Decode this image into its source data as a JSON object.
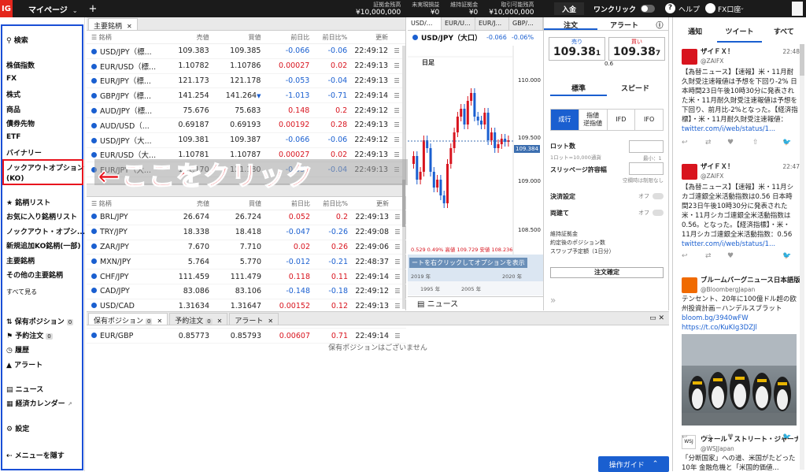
{
  "topbar": {
    "logo": "IG",
    "my_page_tab": "マイページ",
    "plus": "+",
    "stats": [
      {
        "label": "証拠金残高",
        "value": "¥10,000,000"
      },
      {
        "label": "未実現損益",
        "value": "¥0"
      },
      {
        "label": "維持証拠金",
        "value": "¥0"
      },
      {
        "label": "取引可能残高",
        "value": "¥10,000,000"
      }
    ],
    "deposit_button": "入金",
    "one_click_label": "ワンクリック",
    "help_label": "ヘルプ",
    "user_label": "FX口座"
  },
  "sidebar": {
    "search_label": "検索",
    "categories": [
      "株価指数",
      "FX",
      "株式",
      "商品",
      "債券先物",
      "ETF",
      "バイナリー"
    ],
    "knockout_line1": "ノックアウトオプション",
    "knockout_line2": "(KO)",
    "lists": [
      {
        "label": "銘柄リスト"
      },
      {
        "label": "お気に入り銘柄リスト"
      },
      {
        "label": "ノックアウト・オプシ..."
      },
      {
        "label": "新規追加KO銘柄(一部)"
      },
      {
        "label": "主要銘柄"
      },
      {
        "label": "その他の主要銘柄"
      }
    ],
    "see_all": "すべて見る",
    "account": [
      {
        "label": "保有ポジション",
        "badge": "0"
      },
      {
        "label": "予約注文",
        "badge": "0"
      },
      {
        "label": "履歴"
      },
      {
        "label": "アラート"
      }
    ],
    "news_label": "ニュース",
    "calendar_label": "経済カレンダー",
    "settings_label": "設定",
    "hide_menu_label": "メニューを隠す"
  },
  "annotation": {
    "text": "←ここをクリック",
    "color": "#e8141e"
  },
  "watchlist": {
    "tab_label": "主要銘柄",
    "headers": {
      "name": "銘柄",
      "sell": "売値",
      "buy": "買値",
      "change": "前日比",
      "pct": "前日比%",
      "time": "更新"
    },
    "rows_top": [
      {
        "name": "USD/JPY（標...",
        "sell": "109.383",
        "buy": "109.385",
        "arrow": "",
        "change": "-0.066",
        "pct": "-0.06",
        "time": "22:49:12"
      },
      {
        "name": "EUR/USD（標...",
        "sell": "1.10782",
        "buy": "1.10786",
        "arrow": "",
        "change": "0.00027",
        "pct": "0.02",
        "time": "22:49:13"
      },
      {
        "name": "EUR/JPY（標...",
        "sell": "121.173",
        "buy": "121.178",
        "arrow": "",
        "change": "-0.053",
        "pct": "-0.04",
        "time": "22:49:13"
      },
      {
        "name": "GBP/JPY（標...",
        "sell": "141.254",
        "buy": "141.264",
        "arrow": "▼",
        "change": "-1.013",
        "pct": "-0.71",
        "time": "22:49:14"
      },
      {
        "name": "AUD/JPY（標...",
        "sell": "75.676",
        "buy": "75.683",
        "arrow": "",
        "change": "0.148",
        "pct": "0.2",
        "time": "22:49:12"
      },
      {
        "name": "AUD/USD（...",
        "sell": "0.69187",
        "buy": "0.69193",
        "arrow": "",
        "change": "0.00192",
        "pct": "0.28",
        "time": "22:49:13"
      },
      {
        "name": "USD/JPY（大...",
        "sell": "109.381",
        "buy": "109.387",
        "arrow": "",
        "change": "-0.066",
        "pct": "-0.06",
        "time": "22:49:12"
      },
      {
        "name": "EUR/USD（大...",
        "sell": "1.10781",
        "buy": "1.10787",
        "arrow": "",
        "change": "0.00027",
        "pct": "0.02",
        "time": "22:49:13"
      },
      {
        "name": "EUR/JPY（大...",
        "sell": "121.170",
        "buy": "121.180",
        "arrow": "",
        "change": "-0.053",
        "pct": "-0.04",
        "time": "22:49:13"
      }
    ],
    "rows_bottom": [
      {
        "name": "BRL/JPY",
        "sell": "26.674",
        "buy": "26.724",
        "arrow": "",
        "change": "0.052",
        "pct": "0.2",
        "time": "22:49:13"
      },
      {
        "name": "TRY/JPY",
        "sell": "18.338",
        "buy": "18.418",
        "arrow": "",
        "change": "-0.047",
        "pct": "-0.26",
        "time": "22:49:08"
      },
      {
        "name": "ZAR/JPY",
        "sell": "7.670",
        "buy": "7.710",
        "arrow": "",
        "change": "0.02",
        "pct": "0.26",
        "time": "22:49:06"
      },
      {
        "name": "MXN/JPY",
        "sell": "5.764",
        "buy": "5.770",
        "arrow": "",
        "change": "-0.012",
        "pct": "-0.21",
        "time": "22:48:37"
      },
      {
        "name": "CHF/JPY",
        "sell": "111.459",
        "buy": "111.479",
        "arrow": "",
        "change": "0.118",
        "pct": "0.11",
        "time": "22:49:14"
      },
      {
        "name": "CAD/JPY",
        "sell": "83.086",
        "buy": "83.106",
        "arrow": "",
        "change": "-0.148",
        "pct": "-0.18",
        "time": "22:49:12"
      },
      {
        "name": "USD/CAD",
        "sell": "1.31634",
        "buy": "1.31647",
        "arrow": "",
        "change": "0.00152",
        "pct": "0.12",
        "time": "22:49:13"
      },
      {
        "name": "USD/CHF",
        "sell": "0.98117",
        "buy": "0.98132",
        "arrow": "▼",
        "change": "-0.00177",
        "pct": "-0.18",
        "time": "22:49:14"
      },
      {
        "name": "EUR/GBP",
        "sell": "0.85773",
        "buy": "0.85793",
        "arrow": "",
        "change": "0.00607",
        "pct": "0.71",
        "time": "22:49:14"
      }
    ]
  },
  "chart_panel": {
    "tabs": [
      "USD/...",
      "EUR/U...",
      "EUR/J...",
      "GBP/...",
      "AUD/...",
      "AUD/..."
    ],
    "title": "USD/JPY（大口）",
    "change": "-0.066",
    "pct": "-0.06%",
    "timeframe": "日足",
    "price_labels": [
      "110.000",
      "109.500",
      "109.384",
      "109.000",
      "108.500"
    ],
    "stats_line": "0.529   0.49%   高値 109.729   安値 108.236",
    "overlay_hint": "ートを右クリックしてオプションを表示",
    "year_labels": [
      "2019 年",
      "2020 年",
      "1995 年",
      "2005 年"
    ],
    "news_label": "ニュース"
  },
  "order_panel": {
    "tab_order": "注文",
    "tab_alert": "アラート",
    "sell_label": "売り",
    "sell_price_main": "109.38",
    "sell_price_small": "1",
    "buy_label": "買い",
    "buy_price_main": "109.38",
    "buy_price_small": "7",
    "spread": "0.6",
    "mode_standard": "標準",
    "mode_speed": "スピード",
    "order_types": [
      "成行",
      "指値\n逆指値",
      "IFD",
      "IFO"
    ],
    "lot_label": "ロット数",
    "lot_sub": "1ロット=10,000通貨",
    "lot_min": "最小：1",
    "slippage_label": "スリッページ許容幅",
    "slippage_sub": "空欄時は制限なし",
    "settle_label": "決済設定",
    "both_label": "両建て",
    "off": "オフ",
    "info": [
      "維持証拠金",
      "約定後のポジション数",
      "スワップ予定額（1日分）"
    ],
    "confirm_button": "注文確定"
  },
  "bottom_panel": {
    "tabs": [
      {
        "label": "保有ポジション",
        "badge": "0"
      },
      {
        "label": "予約注文",
        "badge": "0"
      },
      {
        "label": "アラート",
        "badge": ""
      }
    ],
    "empty_message": "保有ポジションはございません",
    "guide_button": "操作ガイド"
  },
  "social": {
    "tabs": [
      "通知",
      "ツイート",
      "すべて"
    ],
    "tweets": [
      {
        "name": "ザイＦＸ！",
        "handle": "@ZAIFX",
        "time": "22:48",
        "body": "【為替ニュース】【速報】米・11月耐久財受注速報値は予想を下回り-2% 日本時間23日午後10時30分に発表された米・11月耐久財受注速報値は予想を下回り、前月比-2%となった。【経済指標】・米・11月耐久財受注速報値：前...",
        "link": "twitter.com/i/web/status/1..."
      },
      {
        "name": "ザイＦＸ！",
        "handle": "@ZAIFX",
        "time": "22:47",
        "body": "【為替ニュース】【速報】米・11月シカゴ連銀全米活動指数は0.56 日本時間23日午後10時30分に発表された米・11月シカゴ連銀全米活動指数は0.56。となった。【経済指標】・米・11月シカゴ連銀全米活動指数：0.56（...",
        "link": "twitter.com/i/web/status/1..."
      },
      {
        "name": "ブルームバーグニュース日本語版",
        "handle": "@BloombergJapan",
        "time": "",
        "body": "テンセント、20年に100億ドル超の欧州投資計画－ハンデルスブラット",
        "link": "bloom.bg/3940wFW",
        "link2": "https://t.co/KuKIg3DZJl"
      },
      {
        "name": "ウォール・ストリート・ジャーナ...",
        "handle": "@WSJJapan",
        "time": "",
        "body": "「分断国家」への道、米国がたどった10年 金融危機と「米国的価値...",
        "link": ""
      }
    ]
  },
  "colors": {
    "accent": "#1a5fd0",
    "positive": "#d8141e",
    "negative": "#1a5fd0",
    "brand": "#e4261c"
  }
}
